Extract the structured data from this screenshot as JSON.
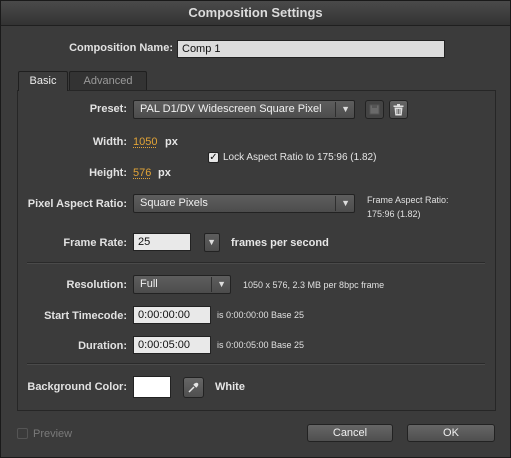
{
  "window": {
    "title": "Composition Settings"
  },
  "comp_name": {
    "label": "Composition Name:",
    "value": "Comp 1"
  },
  "tabs": [
    {
      "label": "Basic",
      "active": true
    },
    {
      "label": "Advanced",
      "active": false
    }
  ],
  "preset": {
    "label": "Preset:",
    "value": "PAL D1/DV Widescreen Square Pixel"
  },
  "width": {
    "label": "Width:",
    "value": "1050",
    "unit": "px"
  },
  "height": {
    "label": "Height:",
    "value": "576",
    "unit": "px"
  },
  "lock_aspect": {
    "checked": true,
    "label": "Lock Aspect Ratio to 175:96 (1.82)"
  },
  "pixel_aspect": {
    "label": "Pixel Aspect Ratio:",
    "value": "Square Pixels",
    "frame_aspect_label": "Frame Aspect Ratio:",
    "frame_aspect_value": "175:96 (1.82)"
  },
  "frame_rate": {
    "label": "Frame Rate:",
    "value": "25",
    "unit": "frames per second"
  },
  "resolution": {
    "label": "Resolution:",
    "value": "Full",
    "info": "1050 x 576, 2.3 MB per 8bpc frame"
  },
  "start_timecode": {
    "label": "Start Timecode:",
    "value": "0:00:00:00",
    "info": "is 0:00:00:00  Base 25"
  },
  "duration": {
    "label": "Duration:",
    "value": "0:00:05:00",
    "info": "is 0:00:05:00  Base 25"
  },
  "background": {
    "label": "Background Color:",
    "color": "#ffffff",
    "color_name": "White"
  },
  "preview": {
    "label": "Preview",
    "checked": false
  },
  "buttons": {
    "cancel": "Cancel",
    "ok": "OK"
  },
  "icons": {
    "save_preset": "save-preset-icon",
    "delete_preset": "trash-icon",
    "eyedropper": "eyedropper-icon"
  }
}
